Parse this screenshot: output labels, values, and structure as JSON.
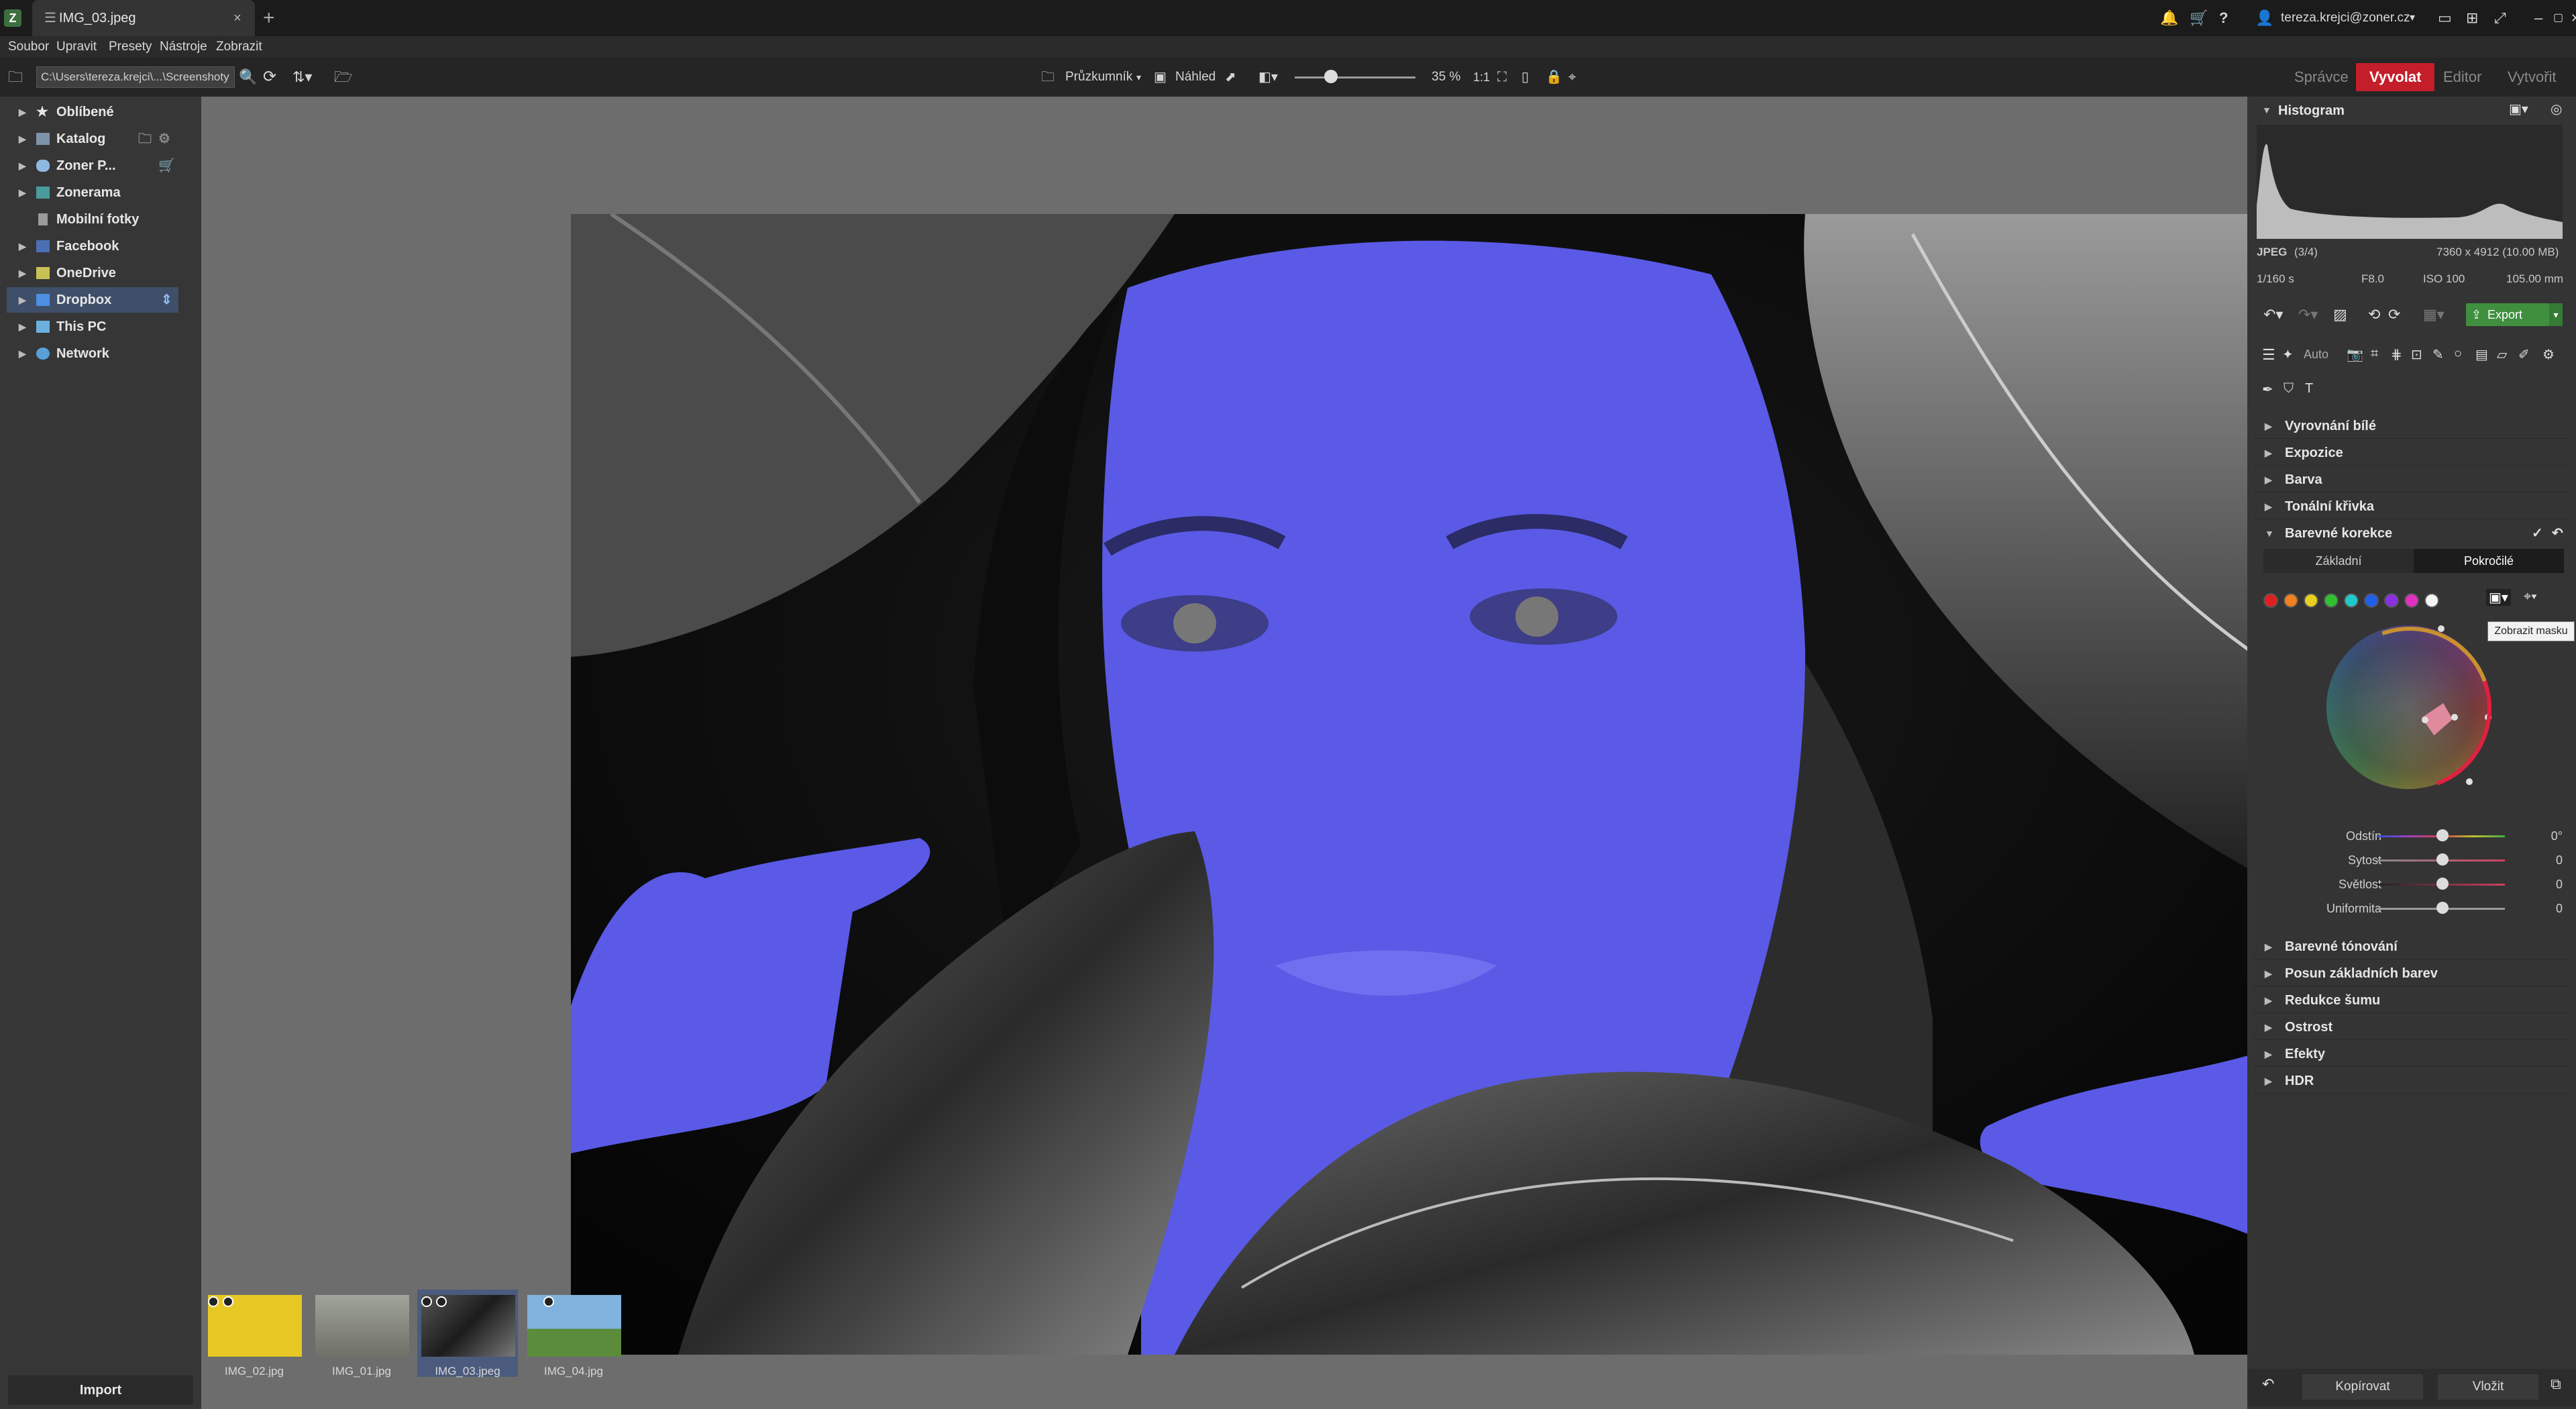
{
  "titlebar": {
    "tab_title": "IMG_03.jpeg",
    "tab_close": "×",
    "tab_add": "+",
    "user": "tereza.krejci@zoner.cz",
    "window_controls": [
      "–",
      "▢",
      "✕"
    ]
  },
  "menu": [
    "Soubor",
    "Upravit",
    "Presety",
    "Nástroje",
    "Zobrazit"
  ],
  "toolbar": {
    "path": "C:\\Users\\tereza.krejci\\...\\Screenshoty",
    "explorer_label": "Průzkumník",
    "preview_label": "Náhled",
    "zoom_value": "35 %"
  },
  "modes": [
    "Správce",
    "Vyvolat",
    "Editor",
    "Vytvořit"
  ],
  "sidebar": {
    "items": [
      {
        "label": "Oblíbené",
        "icon": "star-icon",
        "color": "#e6e6e6"
      },
      {
        "label": "Katalog",
        "icon": "catalog-icon",
        "color": "#9ab"
      },
      {
        "label": "Zoner P...",
        "icon": "cloud-icon",
        "color": "#8fb8e0"
      },
      {
        "label": "Zonerama",
        "icon": "zonerama-icon",
        "color": "#6aa"
      },
      {
        "label": "Mobilní fotky",
        "icon": "phone-icon",
        "color": "#bbb"
      },
      {
        "label": "Facebook",
        "icon": "facebook-icon",
        "color": "#4a6fb5"
      },
      {
        "label": "OneDrive",
        "icon": "onedrive-icon",
        "color": "#c7c055"
      },
      {
        "label": "Dropbox",
        "icon": "dropbox-icon",
        "color": "#4d8fe0"
      },
      {
        "label": "This PC",
        "icon": "pc-icon",
        "color": "#6cb0e0"
      },
      {
        "label": "Network",
        "icon": "network-icon",
        "color": "#5aa0d8"
      }
    ],
    "import_label": "Import"
  },
  "filmstrip": [
    {
      "name": "IMG_02.jpg",
      "color": "#e8c825"
    },
    {
      "name": "IMG_01.jpg",
      "color": "#8d8f86"
    },
    {
      "name": "IMG_03.jpeg",
      "color": "#3a3a55"
    },
    {
      "name": "IMG_04.jpg",
      "color": "#5e8fb5"
    }
  ],
  "right_panel": {
    "histogram_title": "Histogram",
    "exif": {
      "format": "JPEG",
      "index": "(3/4)",
      "dimensions": "7360 x 4912 (10.00 MB)",
      "shutter": "1/160 s",
      "aperture": "F8.0",
      "iso": "ISO 100",
      "focal": "105.00 mm"
    },
    "export_label": "Export",
    "auto_label": "Auto",
    "sections_top": [
      "Vyrovnání bílé",
      "Expozice",
      "Barva",
      "Tonální křivka"
    ],
    "active_section": "Barevné korekce",
    "tabs": {
      "basic": "Základní",
      "advanced": "Pokročilé"
    },
    "swatches": [
      "#e02020",
      "#f08020",
      "#e8d020",
      "#30c030",
      "#20c8c8",
      "#2060e8",
      "#8a30e0",
      "#e030c0",
      "#f5f5f5"
    ],
    "tooltip": "Zobrazit masku",
    "sliders": [
      {
        "label": "Odstín",
        "value": "0°",
        "fill": 0.5
      },
      {
        "label": "Sytost",
        "value": "0",
        "fill": 0.5
      },
      {
        "label": "Světlost",
        "value": "0",
        "fill": 0.5
      },
      {
        "label": "Uniformita",
        "value": "0",
        "fill": 0.5
      }
    ],
    "sections_bottom": [
      "Barevné tónování",
      "Posun základních barev",
      "Redukce šumu",
      "Ostrost",
      "Efekty",
      "HDR"
    ],
    "copy_label": "Kopírovat",
    "paste_label": "Vložit"
  },
  "colors": {
    "mask": "#5a5ae6",
    "accent": "#c41e2a",
    "export": "#3f8f3f"
  }
}
